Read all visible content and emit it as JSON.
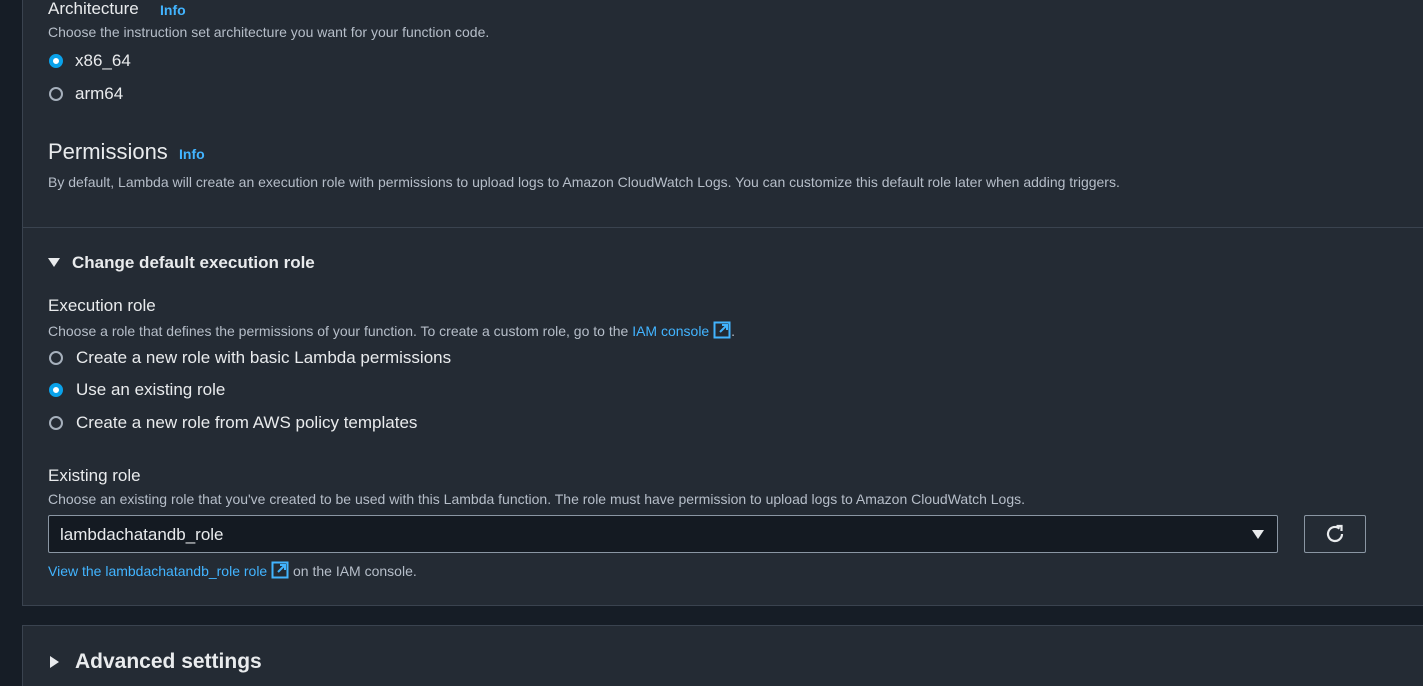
{
  "architecture": {
    "title": "Architecture",
    "info": "Info",
    "description": "Choose the instruction set architecture you want for your function code.",
    "options": [
      "x86_64",
      "arm64"
    ],
    "selected": "x86_64"
  },
  "permissions": {
    "title": "Permissions",
    "info": "Info",
    "description": "By default, Lambda will create an execution role with permissions to upload logs to Amazon CloudWatch Logs. You can customize this default role later when adding triggers."
  },
  "change_role": {
    "toggle_label": "Change default execution role",
    "expanded": true,
    "execution_role": {
      "label": "Execution role",
      "description": "Choose a role that defines the permissions of your function. To create a custom role, go to the",
      "link": "IAM console",
      "description_end": ".",
      "options": [
        "Create a new role with basic Lambda permissions",
        "Use an existing role",
        "Create a new role from AWS policy templates"
      ],
      "selected": "Use an existing role"
    },
    "existing_role": {
      "label": "Existing role",
      "description": "Choose an existing role that you've created to be used with this Lambda function. The role must have permission to upload logs to Amazon CloudWatch Logs.",
      "value": "lambdachatandb_role",
      "view_link": "View the lambdachatandb_role role",
      "view_suffix": "on the IAM console."
    }
  },
  "advanced": {
    "toggle_label": "Advanced settings"
  },
  "colors": {
    "accent": "#0aa2ea",
    "link": "#42b4ff",
    "panel": "#242b34"
  }
}
